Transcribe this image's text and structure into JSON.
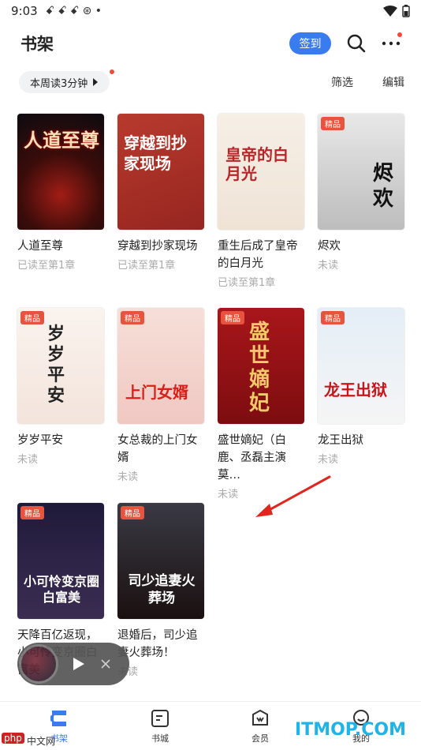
{
  "status_bar": {
    "time": "9:03",
    "notif_icons": "ꗃ ꗃ ꗃ ⊛ •"
  },
  "header": {
    "title": "书架",
    "checkin_label": "签到"
  },
  "toolbar": {
    "reading_time": "本周读3分钟",
    "filter_label": "筛选",
    "edit_label": "编辑"
  },
  "books": [
    {
      "title": "人道至尊",
      "status": "已读至第1章",
      "badge": "",
      "cover_text": "人道至尊"
    },
    {
      "title": "穿越到抄家现场",
      "status": "已读至第1章",
      "badge": "",
      "cover_text": "穿越到抄家现场"
    },
    {
      "title": "重生后成了皇帝的白月光",
      "status": "已读至第1章",
      "badge": "",
      "cover_text": "皇帝的白月光"
    },
    {
      "title": "烬欢",
      "status": "未读",
      "badge": "精品",
      "cover_text": "烬欢"
    },
    {
      "title": "岁岁平安",
      "status": "未读",
      "badge": "精品",
      "cover_text": "岁岁平安"
    },
    {
      "title": "女总裁的上门女婿",
      "status": "未读",
      "badge": "精品",
      "cover_text": "上门女婿"
    },
    {
      "title": "盛世嫡妃（白鹿、丞磊主演莫…",
      "status": "未读",
      "badge": "精品",
      "cover_text": "盛世嫡妃"
    },
    {
      "title": "龙王出狱",
      "status": "未读",
      "badge": "精品",
      "cover_text": "龙王出狱"
    },
    {
      "title": "天降百亿返现，小可怜变京圈白富美",
      "status": "",
      "badge": "精品",
      "cover_text": "小可怜变京圈白富美"
    },
    {
      "title": "退婚后，司少追妻火葬场！",
      "status": "未读",
      "badge": "精品",
      "cover_text": "司少追妻火葬场"
    }
  ],
  "bottom_nav": [
    {
      "label": "书架",
      "icon": "bookshelf-icon"
    },
    {
      "label": "书城",
      "icon": "bookstore-icon"
    },
    {
      "label": "会员",
      "icon": "vip-icon"
    },
    {
      "label": "我的",
      "icon": "profile-icon"
    }
  ],
  "watermark": "ITMOP.COM",
  "php_mark": "php",
  "php_mark_text": "中文网"
}
